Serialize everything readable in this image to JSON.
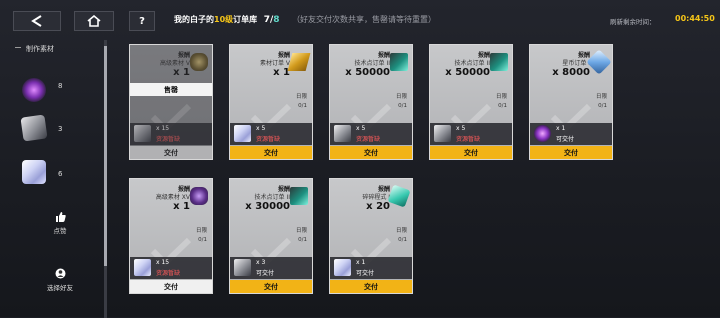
{
  "header": {
    "title_prefix": "我的",
    "title_name": "白子",
    "title_of": "的",
    "title_level": "10级",
    "title_suffix": "订单库",
    "count_current": "7",
    "count_sep": "/",
    "count_total": "8",
    "note": "（好友交付次数共享，售罄请等待重置）",
    "refresh_label": "刷新剩余时间：",
    "timer": "00:44:50"
  },
  "sidebar": {
    "section_label": "制作素材",
    "materials": [
      {
        "count": "8",
        "icon": "purple-orb-icon"
      },
      {
        "count": "3",
        "icon": "silver-card-icon"
      },
      {
        "count": "6",
        "icon": "crystal-cube-icon"
      }
    ],
    "like_label": "点赞",
    "friend_label": "选择好友"
  },
  "cards": [
    {
      "header": "报酬",
      "name": "高级素材 V",
      "qty": "x 1",
      "limit_label": "",
      "limit_value": "",
      "req_qty": "x 15",
      "req_status": "资源暂缺",
      "button": "交付",
      "sold": true,
      "sold_label": "售罄",
      "req_icon": "silver-card-icon",
      "reward_icon": "ore-icon"
    },
    {
      "header": "报酬",
      "name": "素材订单 V",
      "qty": "x 1",
      "limit_label": "日限",
      "limit_value": "0/1",
      "req_qty": "x 5",
      "req_status": "资源暂缺",
      "button": "交付",
      "sold": false,
      "req_icon": "crystal-cube-icon",
      "reward_icon": "gold-bars-icon"
    },
    {
      "header": "报酬",
      "name": "技术点订单 II",
      "qty": "x 50000",
      "limit_label": "日限",
      "limit_value": "0/1",
      "req_qty": "x 5",
      "req_status": "资源暂缺",
      "button": "交付",
      "sold": false,
      "req_icon": "silver-card-icon",
      "reward_icon": "exp-chip-icon"
    },
    {
      "header": "报酬",
      "name": "技术点订单 II",
      "qty": "x 50000",
      "limit_label": "日限",
      "limit_value": "0/1",
      "req_qty": "x 5",
      "req_status": "资源暂缺",
      "button": "交付",
      "sold": false,
      "req_icon": "silver-card-icon",
      "reward_icon": "exp-chip-icon"
    },
    {
      "header": "报酬",
      "name": "星币订单 I",
      "qty": "x 8000",
      "limit_label": "日限",
      "limit_value": "0/1",
      "req_qty": "x 1",
      "req_status": "可交付",
      "button": "交付",
      "sold": false,
      "req_icon": "purple-orb-icon",
      "reward_icon": "star-coin-icon"
    },
    {
      "header": "报酬",
      "name": "高级素材 XV",
      "qty": "x 1",
      "limit_label": "日限",
      "limit_value": "0/1",
      "req_qty": "x 15",
      "req_status": "资源暂缺",
      "button": "交付",
      "sold": false,
      "req_icon": "crystal-cube-icon",
      "reward_icon": "purple-ore-icon"
    },
    {
      "header": "报酬",
      "name": "技术点订单 II",
      "qty": "x 30000",
      "limit_label": "日限",
      "limit_value": "0/1",
      "req_qty": "x 3",
      "req_status": "可交付",
      "button": "交付",
      "sold": false,
      "req_icon": "silver-card-icon",
      "reward_icon": "exp-chip-icon"
    },
    {
      "header": "报酬",
      "name": "碎碎程式 I",
      "qty": "x 20",
      "limit_label": "日限",
      "limit_value": "0/1",
      "req_qty": "x 1",
      "req_status": "可交付",
      "button": "交付",
      "sold": false,
      "req_icon": "crystal-cube-icon",
      "reward_icon": "teal-program-icon"
    }
  ],
  "colors": {
    "accent": "#f2b316",
    "status_missing": "#ff5a5a",
    "status_ok": "#ffffff",
    "count_teal": "#60d7c8"
  }
}
